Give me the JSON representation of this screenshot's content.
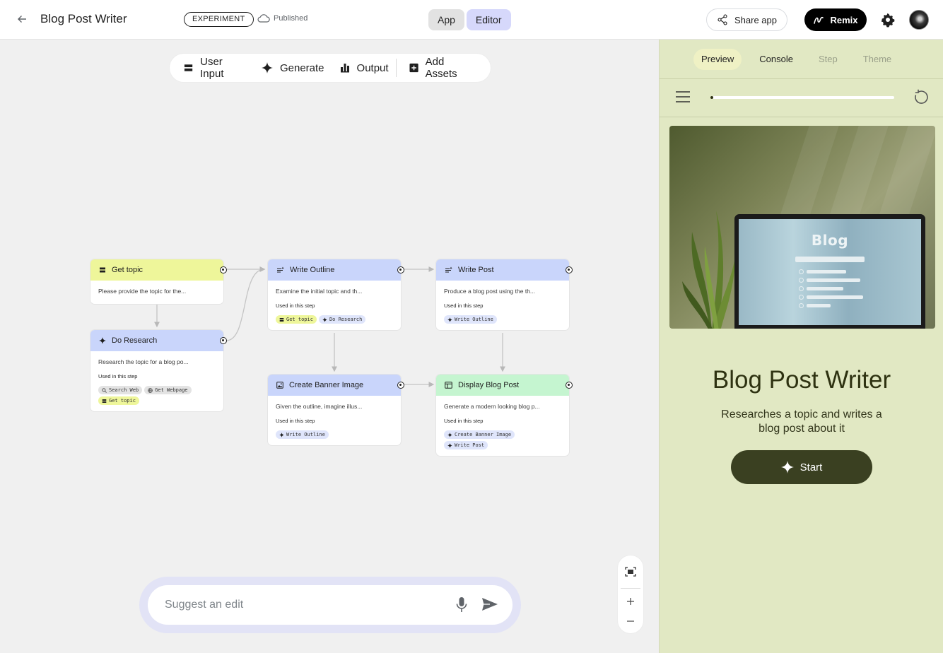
{
  "header": {
    "title": "Blog Post Writer",
    "badge": "EXPERIMENT",
    "status": "Published",
    "modes": [
      "App",
      "Editor"
    ],
    "share_label": "Share app",
    "remix_label": "Remix"
  },
  "toolbar": {
    "user_input": "User Input",
    "generate": "Generate",
    "output": "Output",
    "add_assets": "Add Assets"
  },
  "nodes": {
    "get_topic": {
      "title": "Get topic",
      "desc": "Please provide the topic for the..."
    },
    "do_research": {
      "title": "Do Research",
      "desc": "Research the topic for a blog po...",
      "used": "Used in this step",
      "chips": [
        "Search Web",
        "Get Webpage",
        "Get topic"
      ]
    },
    "write_outline": {
      "title": "Write Outline",
      "desc": "Examine the initial topic and th...",
      "used": "Used in this step",
      "chips": [
        "Get topic",
        "Do Research"
      ]
    },
    "write_post": {
      "title": "Write Post",
      "desc": "Produce a blog post using the th...",
      "used": "Used in this step",
      "chips": [
        "Write Outline"
      ]
    },
    "create_banner": {
      "title": "Create Banner Image",
      "desc": "Given the outline, imagine illus...",
      "used": "Used in this step",
      "chips": [
        "Write Outline"
      ]
    },
    "display_post": {
      "title": "Display Blog Post",
      "desc": "Generate a modern looking blog p...",
      "used": "Used in this step",
      "chips": [
        "Create Banner Image",
        "Write Post"
      ]
    }
  },
  "suggest": {
    "placeholder": "Suggest an edit"
  },
  "panel": {
    "tabs": [
      "Preview",
      "Console",
      "Step",
      "Theme"
    ],
    "progress": 0.01,
    "hero_text": "Blog",
    "title": "Blog Post Writer",
    "subtitle": "Researches a topic and writes a blog post about it",
    "start_label": "Start"
  },
  "colors": {
    "input_node": "#eef69a",
    "generate_node": "#c9d5fb",
    "output_node": "#c5f5d0",
    "editor_active": "#d6d8fb",
    "panel_bg": "#e1e8c3",
    "start_button": "#3a4021"
  }
}
